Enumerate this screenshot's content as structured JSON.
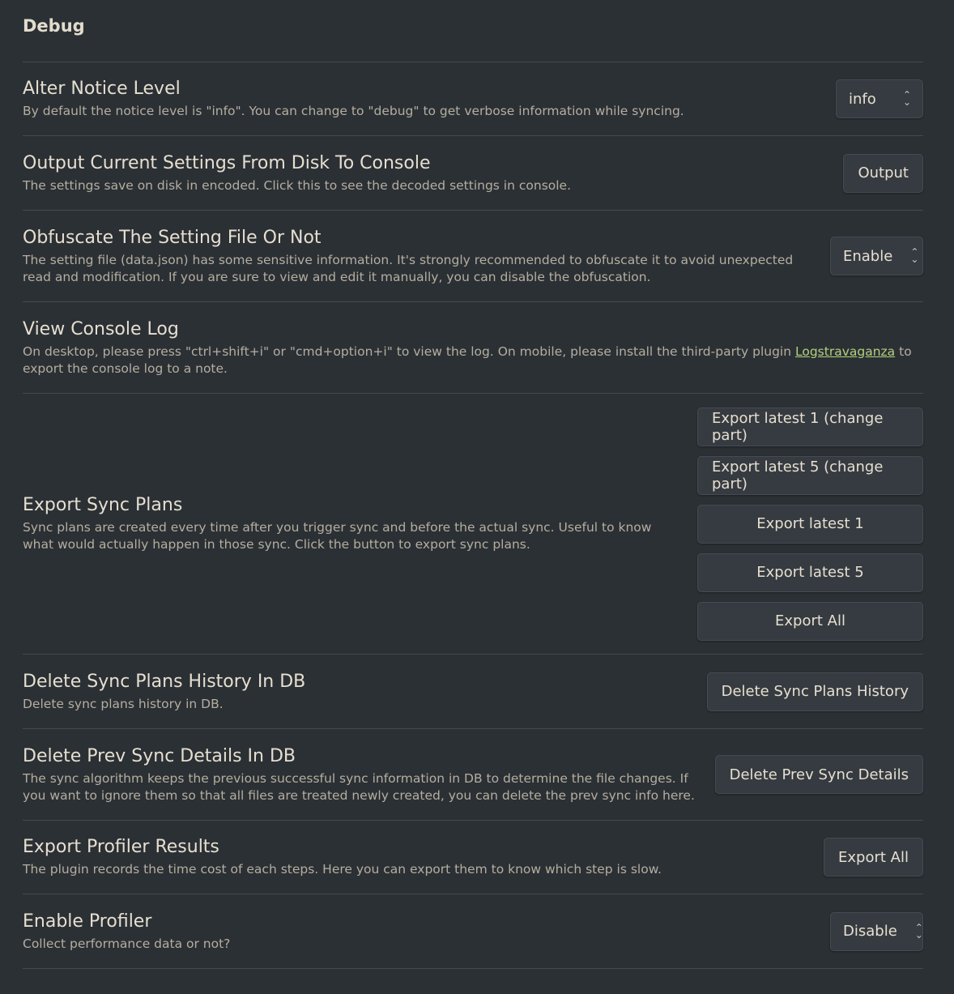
{
  "section_title": "Debug",
  "settings": {
    "notice": {
      "name": "Alter Notice Level",
      "desc": "By default the notice level is \"info\". You can change to \"debug\" to get verbose information while syncing.",
      "value": "info"
    },
    "output": {
      "name": "Output Current Settings From Disk To Console",
      "desc": "The settings save on disk in encoded. Click this to see the decoded settings in console.",
      "button": "Output"
    },
    "obfuscate": {
      "name": "Obfuscate The Setting File Or Not",
      "desc": "The setting file (data.json) has some sensitive information. It's strongly recommended to obfuscate it to avoid unexpected read and modification. If you are sure to view and edit it manually, you can disable the obfuscation.",
      "value": "Enable"
    },
    "console_log": {
      "name": "View Console Log",
      "desc_before": "On desktop, please press \"ctrl+shift+i\" or \"cmd+option+i\" to view the log. On mobile, please install the third-party plugin ",
      "link": "Logstravaganza",
      "desc_after": " to export the console log to a note."
    },
    "export_plans": {
      "name": "Export Sync Plans",
      "desc": "Sync plans are created every time after you trigger sync and before the actual sync. Useful to know what would actually happen in those sync. Click the button to export sync plans.",
      "buttons": [
        "Export latest 1 (change part)",
        "Export latest 5 (change part)",
        "Export latest 1",
        "Export latest 5",
        "Export All"
      ]
    },
    "delete_plans": {
      "name": "Delete Sync Plans History In DB",
      "desc": "Delete sync plans history in DB.",
      "button": "Delete Sync Plans History"
    },
    "delete_prev": {
      "name": "Delete Prev Sync Details In DB",
      "desc": "The sync algorithm keeps the previous successful sync information in DB to determine the file changes. If you want to ignore them so that all files are treated newly created, you can delete the prev sync info here.",
      "button": "Delete Prev Sync Details"
    },
    "profiler_results": {
      "name": "Export Profiler Results",
      "desc": "The plugin records the time cost of each steps. Here you can export them to know which step is slow.",
      "button": "Export All"
    },
    "profiler": {
      "name": "Enable Profiler",
      "desc": "Collect performance data or not?",
      "value": "Disable"
    }
  }
}
